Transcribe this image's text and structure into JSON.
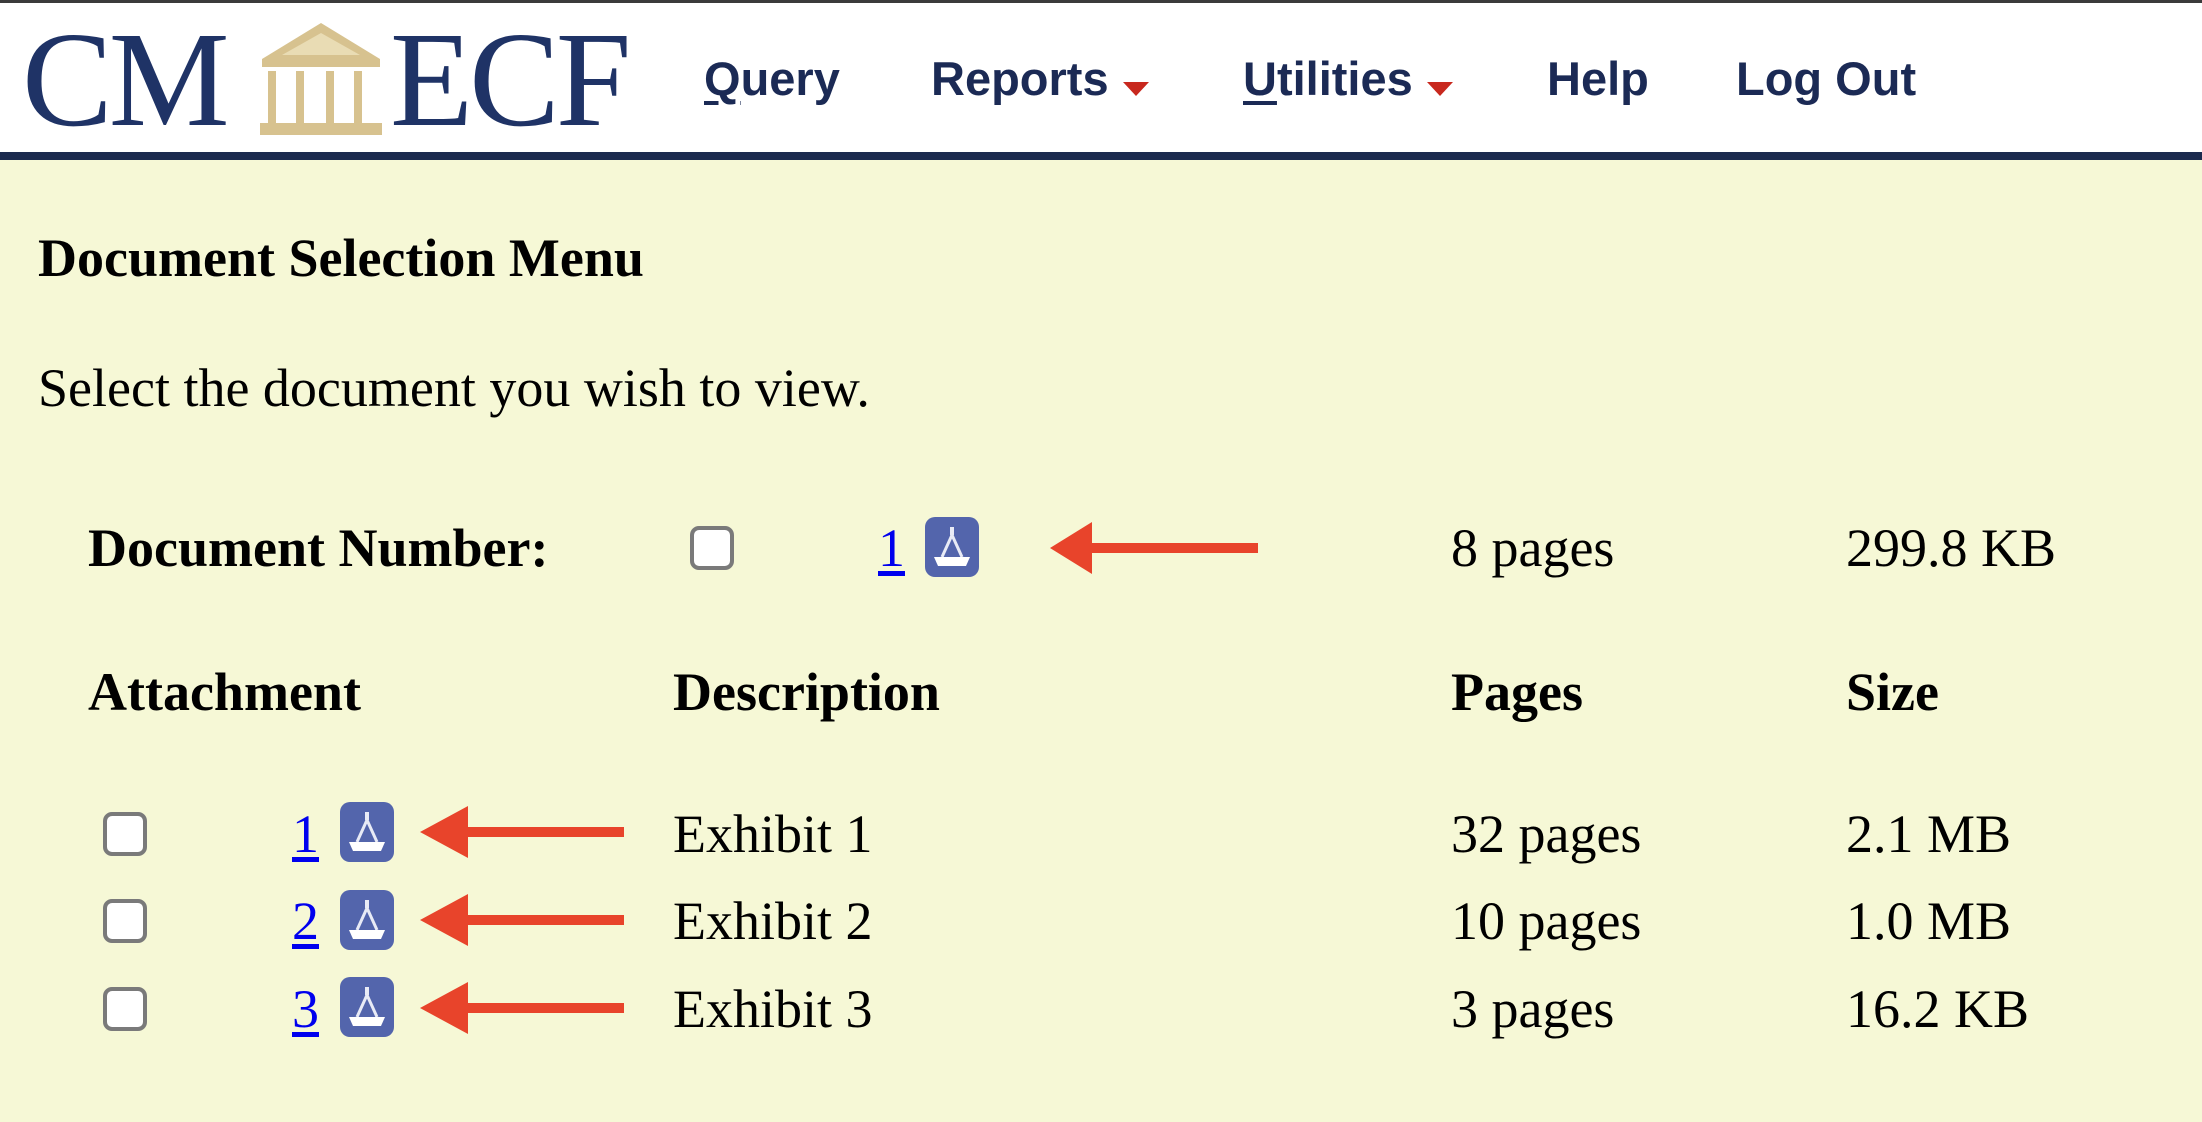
{
  "app": {
    "logo_left": "CM",
    "logo_right": "ECF",
    "colors": {
      "logo_text": "#1f3366",
      "logo_building": "#d7c28f",
      "nav_text": "#1b2a55",
      "nav_caret": "#c8281e",
      "header_border": "#1b2a4e",
      "page_background": "#f6f8d6",
      "link": "#0000ee",
      "pdf_icon": "#5365ac",
      "annotation_arrow": "#e8442b"
    }
  },
  "nav": {
    "items": [
      {
        "label_underlined": "Q",
        "label_rest": "uery",
        "has_dropdown": false
      },
      {
        "label_underlined": "",
        "label_rest": "Reports",
        "has_dropdown": true
      },
      {
        "label_underlined": "U",
        "label_rest": "tilities",
        "has_dropdown": true
      },
      {
        "label_underlined": "",
        "label_rest": "Help",
        "has_dropdown": false
      },
      {
        "label_underlined": "",
        "label_rest": "Log Out",
        "has_dropdown": false
      }
    ]
  },
  "page": {
    "title": "Document Selection Menu",
    "instructions": "Select the document you wish to view."
  },
  "main_document": {
    "label": "Document Number:",
    "number": "1",
    "pages": "8 pages",
    "size": "299.8 KB",
    "checked": false,
    "icon": "pdf-view-icon"
  },
  "attachments_table": {
    "headers": {
      "attachment": "Attachment",
      "description": "Description",
      "pages": "Pages",
      "size": "Size"
    },
    "rows": [
      {
        "number": "1",
        "description": "Exhibit 1",
        "pages": "32 pages",
        "size": "2.1 MB",
        "checked": false
      },
      {
        "number": "2",
        "description": "Exhibit 2",
        "pages": "10 pages",
        "size": "1.0 MB",
        "checked": false
      },
      {
        "number": "3",
        "description": "Exhibit 3",
        "pages": "3 pages",
        "size": "16.2 KB",
        "checked": false
      }
    ]
  },
  "annotations": {
    "arrows": [
      {
        "points_to": "main-document-link"
      },
      {
        "points_to": "attachment-1-link"
      },
      {
        "points_to": "attachment-2-link"
      },
      {
        "points_to": "attachment-3-link"
      }
    ]
  }
}
